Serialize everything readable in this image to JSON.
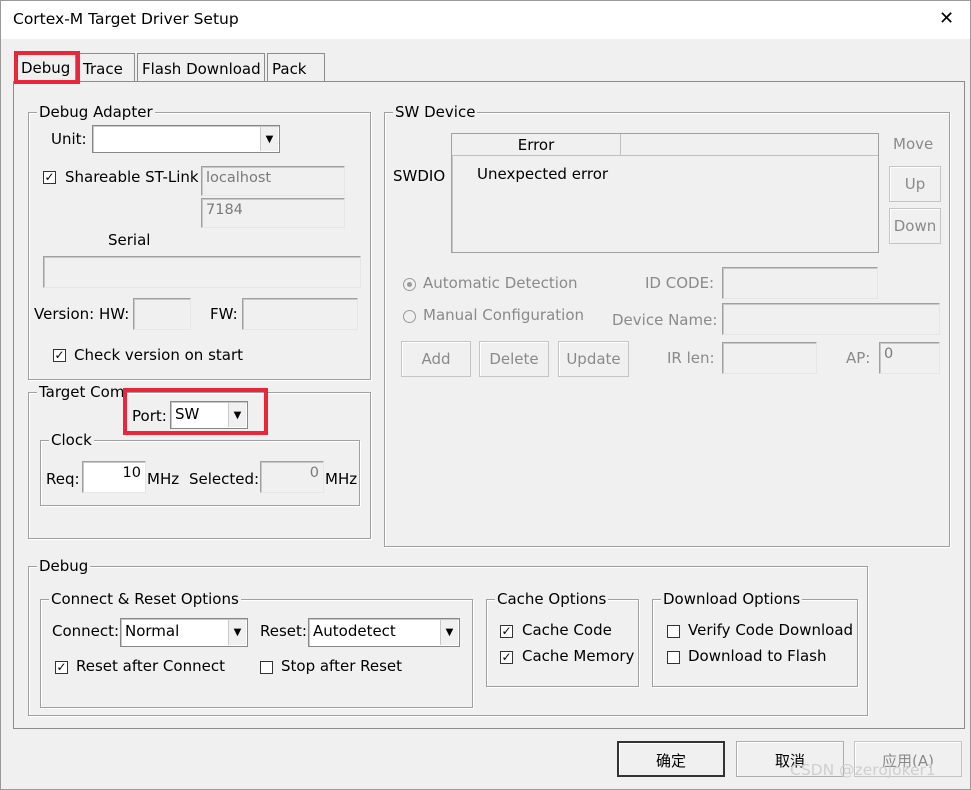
{
  "window": {
    "title": "Cortex-M Target Driver Setup"
  },
  "tabs": [
    {
      "label": "Debug"
    },
    {
      "label": "Trace"
    },
    {
      "label": "Flash Download"
    },
    {
      "label": "Pack"
    }
  ],
  "debug_adapter": {
    "title": "Debug Adapter",
    "unit_label": "Unit:",
    "unit_value": "",
    "shareable_label": "Shareable ST-Link",
    "shareable_checked": true,
    "host_value": "localhost",
    "port_value": "7184",
    "serial_label": "Serial",
    "serial_value": "",
    "version_hw_label": "Version: HW:",
    "version_hw_value": "",
    "version_fw_label": "FW:",
    "version_fw_value": "",
    "check_version_label": "Check version on start",
    "check_version_checked": true
  },
  "target_com": {
    "title": "Target Com",
    "port_label": "Port:",
    "port_value": "SW",
    "clock": {
      "title": "Clock",
      "req_label": "Req:",
      "req_value": "10",
      "req_unit": "MHz",
      "selected_label": "Selected:",
      "selected_value": "0",
      "selected_unit": "MHz"
    }
  },
  "sw_device": {
    "title": "SW Device",
    "swdio_label": "SWDIO",
    "columns": [
      "Error",
      ""
    ],
    "rows": [
      "Unexpected error"
    ],
    "move_label": "Move",
    "up_label": "Up",
    "down_label": "Down",
    "auto_detect_label": "Automatic Detection",
    "manual_config_label": "Manual Configuration",
    "id_code_label": "ID CODE:",
    "id_code_value": "",
    "device_name_label": "Device Name:",
    "device_name_value": "",
    "ir_len_label": "IR len:",
    "ir_len_value": "",
    "ap_label": "AP:",
    "ap_value": "0",
    "add_label": "Add",
    "delete_label": "Delete",
    "update_label": "Update"
  },
  "debug_section": {
    "title": "Debug",
    "connect_reset": {
      "title": "Connect & Reset Options",
      "connect_label": "Connect:",
      "connect_value": "Normal",
      "reset_label": "Reset:",
      "reset_value": "Autodetect",
      "reset_after_connect_label": "Reset after Connect",
      "reset_after_connect_checked": true,
      "stop_after_reset_label": "Stop after Reset",
      "stop_after_reset_checked": false
    },
    "cache_options": {
      "title": "Cache Options",
      "cache_code_label": "Cache Code",
      "cache_code_checked": true,
      "cache_memory_label": "Cache Memory",
      "cache_memory_checked": true
    },
    "download_options": {
      "title": "Download Options",
      "verify_label": "Verify Code Download",
      "verify_checked": false,
      "download_flash_label": "Download to Flash",
      "download_flash_checked": false
    }
  },
  "footer": {
    "ok_label": "确定",
    "cancel_label": "取消",
    "apply_label": "应用(A)"
  },
  "watermark": "CSDN @zerojoker1",
  "colors": {
    "highlight": "#e8283a",
    "window_bg": "#f0f0f0",
    "disabled_text": "#8a8a8a"
  }
}
